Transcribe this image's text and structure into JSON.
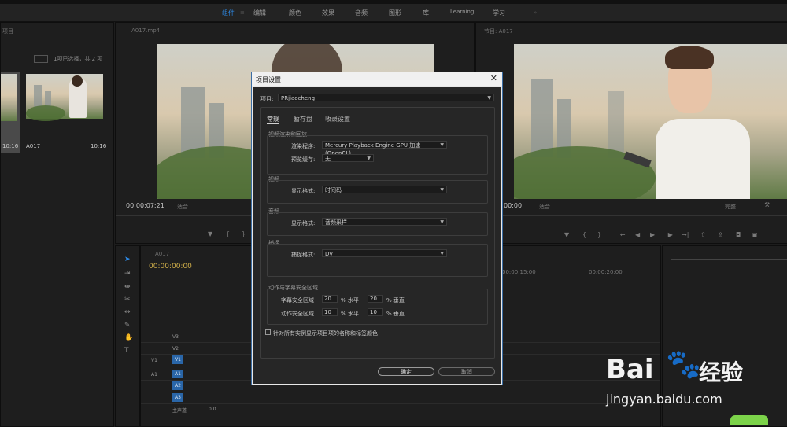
{
  "workspace_tabs": [
    "组件",
    "编辑",
    "颜色",
    "效果",
    "音频",
    "图形",
    "库",
    "Learning",
    "学习"
  ],
  "active_tab": "组件",
  "project_panel": {
    "title": "项目",
    "selection_text": "1项已选择，共 2 项",
    "items": [
      {
        "name": "",
        "duration": "10:16"
      },
      {
        "name": "A017",
        "duration": "10:16"
      }
    ]
  },
  "source_monitor": {
    "title": "A017.mp4",
    "timecode": "00:00:07:21",
    "fit_label": "适合"
  },
  "program_monitor": {
    "title": "节目: A017",
    "timecode": "00:00",
    "fit_label": "适合",
    "quality": "完整"
  },
  "timeline": {
    "title": "A017",
    "timecode": "00:00:00:00",
    "ruler": [
      "00:00:15:00",
      "00:00:20:00"
    ],
    "tracks": [
      {
        "target": "",
        "name": "V3"
      },
      {
        "target": "",
        "name": "V2"
      },
      {
        "target": "V1",
        "name": "V1"
      },
      {
        "target": "A1",
        "name": "A1"
      },
      {
        "target": "",
        "name": "A2"
      },
      {
        "target": "",
        "name": "A3"
      }
    ],
    "master_label": "主声道",
    "master_value": "0.0"
  },
  "dialog": {
    "title": "项目设置",
    "close": "✕",
    "project_label": "项目:",
    "project_name": "PRjiaocheng",
    "tabs": [
      "常规",
      "暂存盘",
      "收录设置"
    ],
    "active_tab": "常规",
    "video_render": {
      "group": "视频渲染和回放",
      "renderer_label": "渲染程序:",
      "renderer_value": "Mercury Playback Engine GPU 加速 (OpenCL)",
      "preview_cache_label": "预览缓存:",
      "preview_cache_value": "无"
    },
    "video": {
      "group": "视频",
      "format_label": "显示格式:",
      "format_value": "时间码"
    },
    "audio": {
      "group": "音频",
      "format_label": "显示格式:",
      "format_value": "音频采样"
    },
    "capture": {
      "group": "捕捉",
      "format_label": "捕捉格式:",
      "format_value": "DV"
    },
    "safe": {
      "group": "动作与字幕安全区域",
      "title_label": "字幕安全区域",
      "title_h": "20",
      "title_v": "20",
      "action_label": "动作安全区域",
      "action_h": "10",
      "action_v": "10",
      "h_unit": "% 水平",
      "v_unit": "% 垂直"
    },
    "checkbox_label": "针对所有实例显示项目项的名称和标签颜色",
    "ok": "确定",
    "cancel": "取消"
  },
  "watermark": {
    "brand": "Bai",
    "brand2": "经验",
    "url": "jingyan.baidu.com"
  }
}
